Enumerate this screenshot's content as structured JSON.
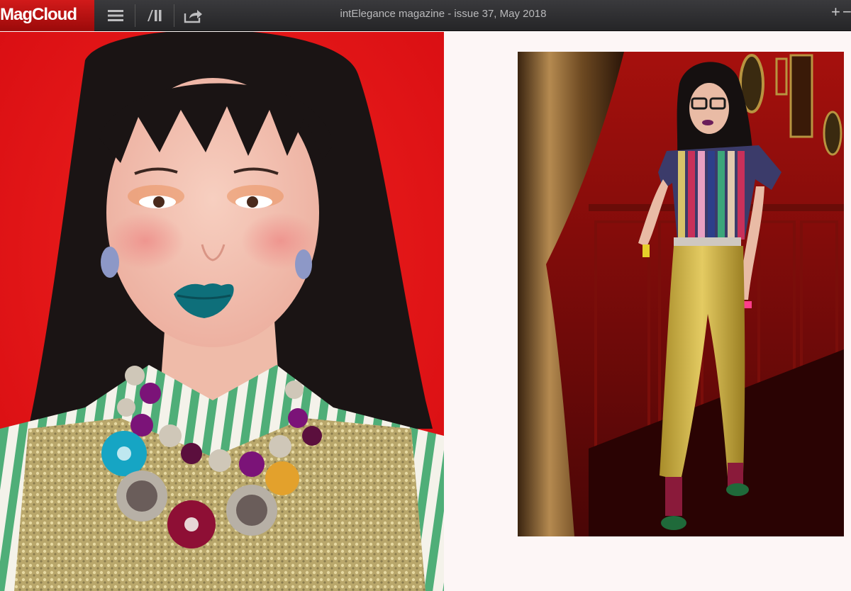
{
  "app": {
    "logo_text": "MagCloud",
    "brand_color": "#c41212"
  },
  "toolbar": {
    "menu_icon": "hamburger-menu-icon",
    "view_icon": "page-layout-icon",
    "share_icon": "share-icon",
    "title": "intElegance magazine - issue 37, May 2018",
    "zoom_in_label": "+",
    "zoom_out_label": "−"
  },
  "spread": {
    "left_page": {
      "image": "portrait-photo",
      "background_color": "#e8121a"
    },
    "right_page": {
      "image": "full-length-fashion-photo",
      "background_color": "#fdf6f6"
    }
  }
}
